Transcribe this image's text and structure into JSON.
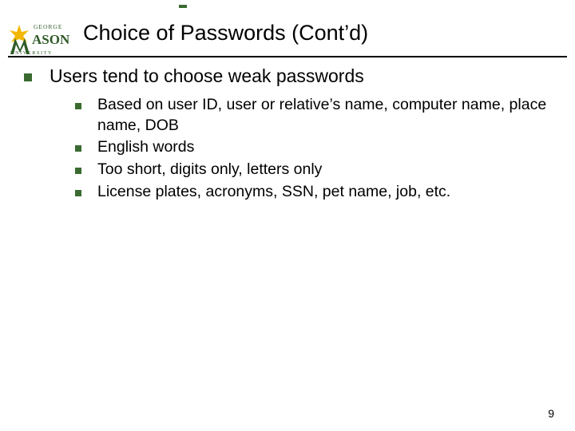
{
  "logo": {
    "top_text": "GEORGE",
    "middle_text": "MASON",
    "bottom_text": "UNIVERSITY"
  },
  "title": "Choice of Passwords (Cont’d)",
  "bullets": {
    "main": "Users tend to choose weak passwords",
    "sub": [
      "Based on user ID, user or relative’s name, computer name, place name, DOB",
      "English words",
      "Too short, digits only, letters only",
      "License plates, acronyms, SSN, pet name, job, etc."
    ]
  },
  "page_number": "9"
}
